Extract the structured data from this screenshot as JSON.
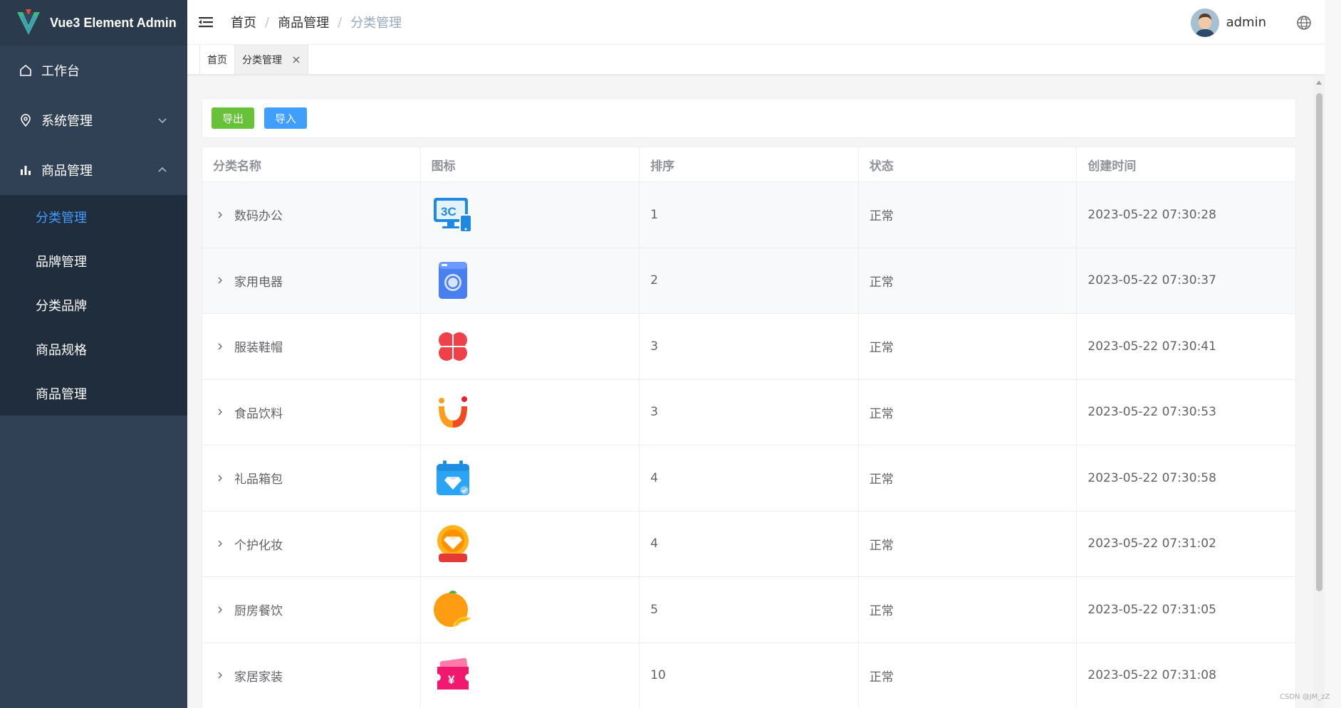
{
  "app": {
    "title": "Vue3 Element Admin"
  },
  "sidebar": {
    "items": [
      {
        "label": "工作台",
        "icon": "home-icon"
      },
      {
        "label": "系统管理",
        "icon": "location-icon"
      },
      {
        "label": "商品管理",
        "icon": "bar-chart-icon"
      }
    ],
    "submenu": [
      {
        "label": "分类管理",
        "active": true
      },
      {
        "label": "品牌管理"
      },
      {
        "label": "分类品牌"
      },
      {
        "label": "商品规格"
      },
      {
        "label": "商品管理"
      }
    ],
    "active_color": "#409eff",
    "bg_color": "#304156"
  },
  "header": {
    "breadcrumb": [
      "首页",
      "商品管理",
      "分类管理"
    ],
    "separator": "/",
    "username": "admin"
  },
  "tags": [
    {
      "label": "首页"
    },
    {
      "label": "分类管理",
      "closable": true
    }
  ],
  "toolbar": {
    "export_label": "导出",
    "import_label": "导入"
  },
  "table": {
    "columns": [
      "分类名称",
      "图标",
      "排序",
      "状态",
      "创建时间"
    ],
    "rows": [
      {
        "name": "数码办公",
        "icon": "3c-digital-icon",
        "sort": "1",
        "status": "正常",
        "created": "2023-05-22 07:30:28"
      },
      {
        "name": "家用电器",
        "icon": "washing-machine-icon",
        "sort": "2",
        "status": "正常",
        "created": "2023-05-22 07:30:37"
      },
      {
        "name": "服装鞋帽",
        "icon": "clover-icon",
        "sort": "3",
        "status": "正常",
        "created": "2023-05-22 07:30:41"
      },
      {
        "name": "食品饮料",
        "icon": "smile-icon",
        "sort": "3",
        "status": "正常",
        "created": "2023-05-22 07:30:53"
      },
      {
        "name": "礼品箱包",
        "icon": "diamond-calendar-icon",
        "sort": "4",
        "status": "正常",
        "created": "2023-05-22 07:30:58"
      },
      {
        "name": "个护化妆",
        "icon": "diamond-badge-icon",
        "sort": "4",
        "status": "正常",
        "created": "2023-05-22 07:31:02"
      },
      {
        "name": "厨房餐饮",
        "icon": "orange-icon",
        "sort": "5",
        "status": "正常",
        "created": "2023-05-22 07:31:05"
      },
      {
        "name": "家居家装",
        "icon": "yen-ticket-icon",
        "sort": "10",
        "status": "正常",
        "created": "2023-05-22 07:31:08"
      }
    ]
  },
  "watermark": "CSDN @JM_zZ"
}
